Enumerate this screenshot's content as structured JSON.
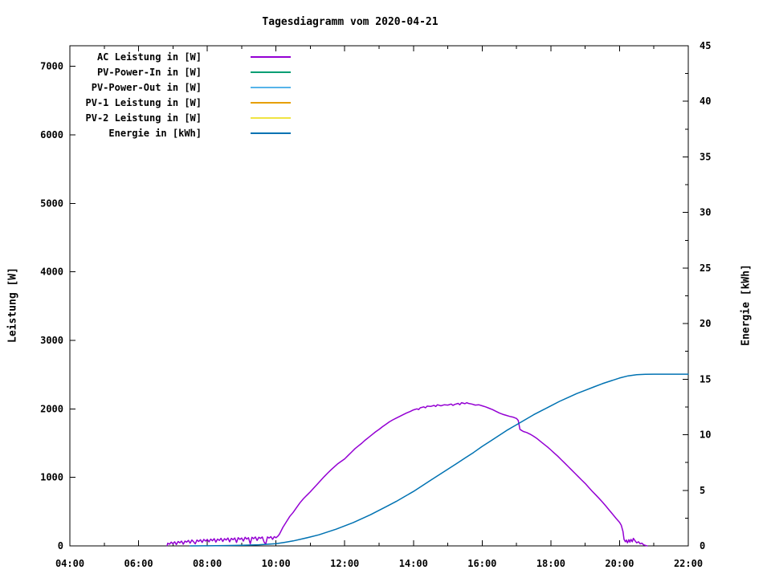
{
  "title": "Tagesdiagramm vom 2020-04-21",
  "chart_data": {
    "type": "line",
    "title": "Tagesdiagramm vom 2020-04-21",
    "grid": false,
    "legend_position": "top-left-inside",
    "x_axis": {
      "min": 4,
      "max": 22,
      "major_ticks": [
        {
          "t": 4,
          "label": "04:00"
        },
        {
          "t": 6,
          "label": "06:00"
        },
        {
          "t": 8,
          "label": "08:00"
        },
        {
          "t": 10,
          "label": "10:00"
        },
        {
          "t": 12,
          "label": "12:00"
        },
        {
          "t": 14,
          "label": "14:00"
        },
        {
          "t": 16,
          "label": "16:00"
        },
        {
          "t": 18,
          "label": "18:00"
        },
        {
          "t": 20,
          "label": "20:00"
        },
        {
          "t": 22,
          "label": "22:00"
        }
      ],
      "minor_ticks": [
        5,
        7,
        9,
        11,
        13,
        15,
        17,
        19,
        21
      ]
    },
    "y1_axis": {
      "label": "Leistung [W]",
      "min": 0,
      "max": 7300,
      "major_ticks": [
        0,
        1000,
        2000,
        3000,
        4000,
        5000,
        6000,
        7000
      ]
    },
    "y2_axis": {
      "label": "Energie [kWh]",
      "min": 0,
      "max": 45,
      "major_ticks": [
        0,
        5,
        10,
        15,
        20,
        25,
        30,
        35,
        40,
        45
      ],
      "minor_ticks": [
        2.5,
        7.5,
        12.5,
        17.5,
        22.5,
        27.5,
        32.5,
        37.5,
        42.5
      ]
    },
    "series": [
      {
        "name": "AC Leistung in [W]",
        "color": "#9400d3",
        "axis": "y1",
        "points": [
          [
            6.83,
            5
          ],
          [
            6.85,
            40
          ],
          [
            6.9,
            25
          ],
          [
            6.95,
            55
          ],
          [
            7.0,
            30
          ],
          [
            7.05,
            60
          ],
          [
            7.1,
            20
          ],
          [
            7.15,
            65
          ],
          [
            7.2,
            45
          ],
          [
            7.25,
            70
          ],
          [
            7.3,
            25
          ],
          [
            7.35,
            70
          ],
          [
            7.4,
            55
          ],
          [
            7.45,
            80
          ],
          [
            7.5,
            40
          ],
          [
            7.55,
            85
          ],
          [
            7.6,
            60
          ],
          [
            7.65,
            30
          ],
          [
            7.7,
            85
          ],
          [
            7.75,
            65
          ],
          [
            7.8,
            90
          ],
          [
            7.85,
            50
          ],
          [
            7.9,
            95
          ],
          [
            7.95,
            70
          ],
          [
            8.0,
            95
          ],
          [
            8.05,
            60
          ],
          [
            8.1,
            100
          ],
          [
            8.15,
            75
          ],
          [
            8.2,
            105
          ],
          [
            8.25,
            55
          ],
          [
            8.3,
            100
          ],
          [
            8.35,
            80
          ],
          [
            8.4,
            110
          ],
          [
            8.45,
            65
          ],
          [
            8.5,
            105
          ],
          [
            8.55,
            85
          ],
          [
            8.6,
            115
          ],
          [
            8.65,
            60
          ],
          [
            8.7,
            110
          ],
          [
            8.75,
            90
          ],
          [
            8.8,
            115
          ],
          [
            8.85,
            50
          ],
          [
            8.9,
            120
          ],
          [
            8.95,
            95
          ],
          [
            9.0,
            115
          ],
          [
            9.05,
            70
          ],
          [
            9.1,
            125
          ],
          [
            9.15,
            100
          ],
          [
            9.2,
            120
          ],
          [
            9.25,
            30
          ],
          [
            9.3,
            125
          ],
          [
            9.35,
            105
          ],
          [
            9.4,
            130
          ],
          [
            9.45,
            80
          ],
          [
            9.5,
            125
          ],
          [
            9.55,
            110
          ],
          [
            9.6,
            130
          ],
          [
            9.65,
            60
          ],
          [
            9.7,
            25
          ],
          [
            9.75,
            130
          ],
          [
            9.8,
            115
          ],
          [
            9.85,
            135
          ],
          [
            9.9,
            95
          ],
          [
            9.95,
            135
          ],
          [
            10.0,
            120
          ],
          [
            10.05,
            140
          ],
          [
            10.1,
            170
          ],
          [
            10.15,
            220
          ],
          [
            10.2,
            270
          ],
          [
            10.3,
            350
          ],
          [
            10.4,
            430
          ],
          [
            10.5,
            490
          ],
          [
            10.6,
            560
          ],
          [
            10.7,
            630
          ],
          [
            10.8,
            690
          ],
          [
            10.9,
            740
          ],
          [
            11.0,
            790
          ],
          [
            11.1,
            845
          ],
          [
            11.2,
            900
          ],
          [
            11.3,
            955
          ],
          [
            11.4,
            1010
          ],
          [
            11.5,
            1060
          ],
          [
            11.6,
            1110
          ],
          [
            11.7,
            1155
          ],
          [
            11.8,
            1200
          ],
          [
            11.9,
            1235
          ],
          [
            12.0,
            1270
          ],
          [
            12.1,
            1320
          ],
          [
            12.2,
            1370
          ],
          [
            12.3,
            1420
          ],
          [
            12.4,
            1460
          ],
          [
            12.5,
            1500
          ],
          [
            12.6,
            1545
          ],
          [
            12.7,
            1585
          ],
          [
            12.8,
            1625
          ],
          [
            12.9,
            1665
          ],
          [
            13.0,
            1700
          ],
          [
            13.1,
            1740
          ],
          [
            13.2,
            1775
          ],
          [
            13.3,
            1810
          ],
          [
            13.4,
            1840
          ],
          [
            13.5,
            1865
          ],
          [
            13.6,
            1890
          ],
          [
            13.7,
            1915
          ],
          [
            13.8,
            1940
          ],
          [
            13.9,
            1960
          ],
          [
            14.0,
            1985
          ],
          [
            14.1,
            2000
          ],
          [
            14.15,
            1990
          ],
          [
            14.2,
            2015
          ],
          [
            14.3,
            2030
          ],
          [
            14.35,
            2015
          ],
          [
            14.4,
            2040
          ],
          [
            14.5,
            2035
          ],
          [
            14.6,
            2050
          ],
          [
            14.65,
            2035
          ],
          [
            14.7,
            2060
          ],
          [
            14.8,
            2045
          ],
          [
            14.9,
            2060
          ],
          [
            15.0,
            2055
          ],
          [
            15.1,
            2070
          ],
          [
            15.15,
            2050
          ],
          [
            15.2,
            2065
          ],
          [
            15.3,
            2080
          ],
          [
            15.35,
            2060
          ],
          [
            15.4,
            2090
          ],
          [
            15.5,
            2075
          ],
          [
            15.55,
            2090
          ],
          [
            15.6,
            2080
          ],
          [
            15.7,
            2070
          ],
          [
            15.8,
            2055
          ],
          [
            15.9,
            2060
          ],
          [
            16.0,
            2045
          ],
          [
            16.1,
            2030
          ],
          [
            16.2,
            2010
          ],
          [
            16.3,
            1990
          ],
          [
            16.4,
            1965
          ],
          [
            16.5,
            1940
          ],
          [
            16.6,
            1920
          ],
          [
            16.7,
            1905
          ],
          [
            16.8,
            1890
          ],
          [
            16.9,
            1880
          ],
          [
            17.0,
            1860
          ],
          [
            17.05,
            1830
          ],
          [
            17.1,
            1700
          ],
          [
            17.15,
            1685
          ],
          [
            17.2,
            1670
          ],
          [
            17.3,
            1655
          ],
          [
            17.4,
            1630
          ],
          [
            17.5,
            1600
          ],
          [
            17.6,
            1565
          ],
          [
            17.7,
            1525
          ],
          [
            17.8,
            1485
          ],
          [
            17.9,
            1445
          ],
          [
            18.0,
            1400
          ],
          [
            18.1,
            1355
          ],
          [
            18.2,
            1310
          ],
          [
            18.3,
            1260
          ],
          [
            18.4,
            1210
          ],
          [
            18.5,
            1160
          ],
          [
            18.6,
            1110
          ],
          [
            18.7,
            1060
          ],
          [
            18.8,
            1010
          ],
          [
            18.9,
            960
          ],
          [
            19.0,
            910
          ],
          [
            19.1,
            855
          ],
          [
            19.2,
            800
          ],
          [
            19.3,
            748
          ],
          [
            19.4,
            695
          ],
          [
            19.5,
            640
          ],
          [
            19.6,
            582
          ],
          [
            19.7,
            522
          ],
          [
            19.8,
            462
          ],
          [
            19.9,
            400
          ],
          [
            20.0,
            345
          ],
          [
            20.05,
            300
          ],
          [
            20.1,
            210
          ],
          [
            20.13,
            95
          ],
          [
            20.17,
            60
          ],
          [
            20.2,
            85
          ],
          [
            20.23,
            45
          ],
          [
            20.27,
            90
          ],
          [
            20.3,
            55
          ],
          [
            20.33,
            95
          ],
          [
            20.37,
            60
          ],
          [
            20.4,
            110
          ],
          [
            20.45,
            75
          ],
          [
            20.5,
            45
          ],
          [
            20.55,
            60
          ],
          [
            20.6,
            30
          ],
          [
            20.65,
            40
          ],
          [
            20.7,
            15
          ],
          [
            20.75,
            8
          ],
          [
            20.8,
            0
          ]
        ]
      },
      {
        "name": "PV-Power-In in [W]",
        "color": "#009e73",
        "axis": "y1",
        "points": []
      },
      {
        "name": "PV-Power-Out in [W]",
        "color": "#56b4e9",
        "axis": "y1",
        "points": []
      },
      {
        "name": "PV-1 Leistung in [W]",
        "color": "#e69f00",
        "axis": "y1",
        "points": []
      },
      {
        "name": "PV-2 Leistung in [W]",
        "color": "#f0e442",
        "axis": "y1",
        "points": []
      },
      {
        "name": "Energie in [kWh]",
        "color": "#0072b2",
        "axis": "y2",
        "points": [
          [
            7.5,
            0
          ],
          [
            8.0,
            0.01
          ],
          [
            8.5,
            0.03
          ],
          [
            9.0,
            0.06
          ],
          [
            9.5,
            0.1
          ],
          [
            10.0,
            0.2
          ],
          [
            10.25,
            0.32
          ],
          [
            10.5,
            0.45
          ],
          [
            10.75,
            0.62
          ],
          [
            11.0,
            0.8
          ],
          [
            11.25,
            1.0
          ],
          [
            11.5,
            1.25
          ],
          [
            11.75,
            1.5
          ],
          [
            12.0,
            1.8
          ],
          [
            12.25,
            2.1
          ],
          [
            12.5,
            2.45
          ],
          [
            12.75,
            2.8
          ],
          [
            13.0,
            3.2
          ],
          [
            13.25,
            3.6
          ],
          [
            13.5,
            4.0
          ],
          [
            13.75,
            4.45
          ],
          [
            14.0,
            4.9
          ],
          [
            14.25,
            5.4
          ],
          [
            14.5,
            5.9
          ],
          [
            14.75,
            6.4
          ],
          [
            15.0,
            6.9
          ],
          [
            15.25,
            7.4
          ],
          [
            15.5,
            7.9
          ],
          [
            15.75,
            8.4
          ],
          [
            16.0,
            8.95
          ],
          [
            16.25,
            9.45
          ],
          [
            16.5,
            9.95
          ],
          [
            16.75,
            10.45
          ],
          [
            17.0,
            10.9
          ],
          [
            17.25,
            11.35
          ],
          [
            17.5,
            11.8
          ],
          [
            17.75,
            12.2
          ],
          [
            18.0,
            12.6
          ],
          [
            18.25,
            13.0
          ],
          [
            18.5,
            13.35
          ],
          [
            18.75,
            13.7
          ],
          [
            19.0,
            14.0
          ],
          [
            19.25,
            14.3
          ],
          [
            19.5,
            14.6
          ],
          [
            19.75,
            14.85
          ],
          [
            20.0,
            15.1
          ],
          [
            20.25,
            15.3
          ],
          [
            20.5,
            15.4
          ],
          [
            20.75,
            15.44
          ],
          [
            21.0,
            15.45
          ],
          [
            22.0,
            15.45
          ]
        ]
      }
    ]
  }
}
